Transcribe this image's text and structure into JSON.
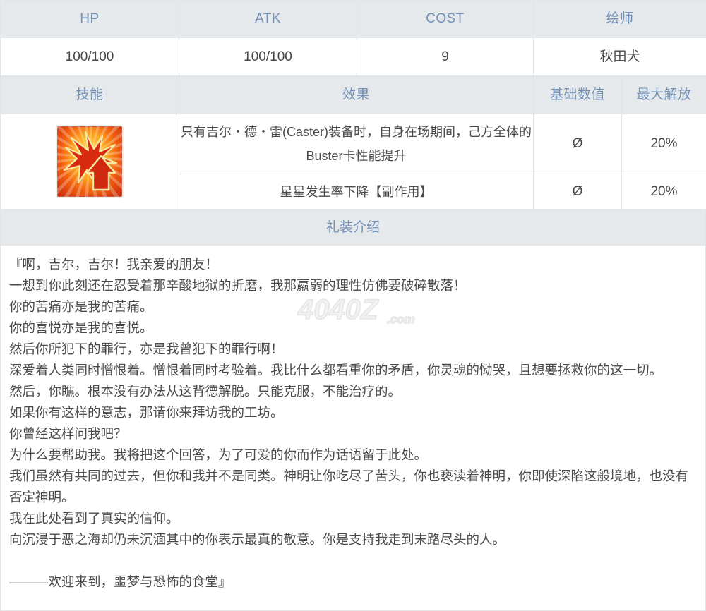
{
  "colors": {
    "header_text": "#7390b6",
    "header_bg": "#e6e9ec",
    "border": "#e3e4e6",
    "body_text": "#4a4a4a",
    "icon_accent": "#e8450d"
  },
  "stat_table": {
    "headers": [
      "HP",
      "ATK",
      "COST",
      "绘师"
    ],
    "values": [
      "100/100",
      "100/100",
      "9",
      "秋田犬"
    ]
  },
  "skill_table": {
    "headers": [
      "技能",
      "效果",
      "基础数值",
      "最大解放"
    ],
    "icon": {
      "name": "buster-up-skill-icon",
      "alt": "Buster性能提升图标"
    },
    "rows": [
      {
        "effect": "只有吉尔・德・雷(Caster)装备时，自身在场期间，己方全体的Buster卡性能提升",
        "base": "Ø",
        "max": "20%"
      },
      {
        "effect": "星星发生率下降【副作用】",
        "base": "Ø",
        "max": "20%"
      }
    ]
  },
  "description": {
    "section_title": "礼装介绍",
    "lines": [
      "『啊，吉尔，吉尔！我亲爱的朋友！",
      "一想到你此刻还在忍受着那辛酸地狱的折磨，我那羸弱的理性仿佛要破碎散落！",
      "你的苦痛亦是我的苦痛。",
      "你的喜悦亦是我的喜悦。",
      "然后你所犯下的罪行，亦是我曾犯下的罪行啊！",
      "深爱着人类同时憎恨着。憎恨着同时考验着。我比什么都看重你的矛盾，你灵魂的恸哭，且想要拯救你的这一切。",
      "然后，你瞧。根本没有办法从这背德解脱。只能克服，不能治疗的。",
      "如果你有这样的意志，那请你来拜访我的工坊。",
      "你曾经这样问我吧？",
      "为什么要帮助我。我将把这个回答，为了可爱的你而作为话语留于此处。",
      "我们虽然有共同的过去，但你和我并不是同类。神明让你吃尽了苦头，你也亵渎着神明，你即使深陷这般境地，也没有否定神明。",
      "我在此处看到了真实的信仰。",
      "向沉浸于恶之海却仍未沉湎其中的你表示最真的敬意。你是支持我走到末路尽头的人。",
      "",
      "———欢迎来到，噩梦与恐怖的食堂』"
    ]
  },
  "watermark": {
    "text": "4040Z",
    "suffix": ".com"
  }
}
